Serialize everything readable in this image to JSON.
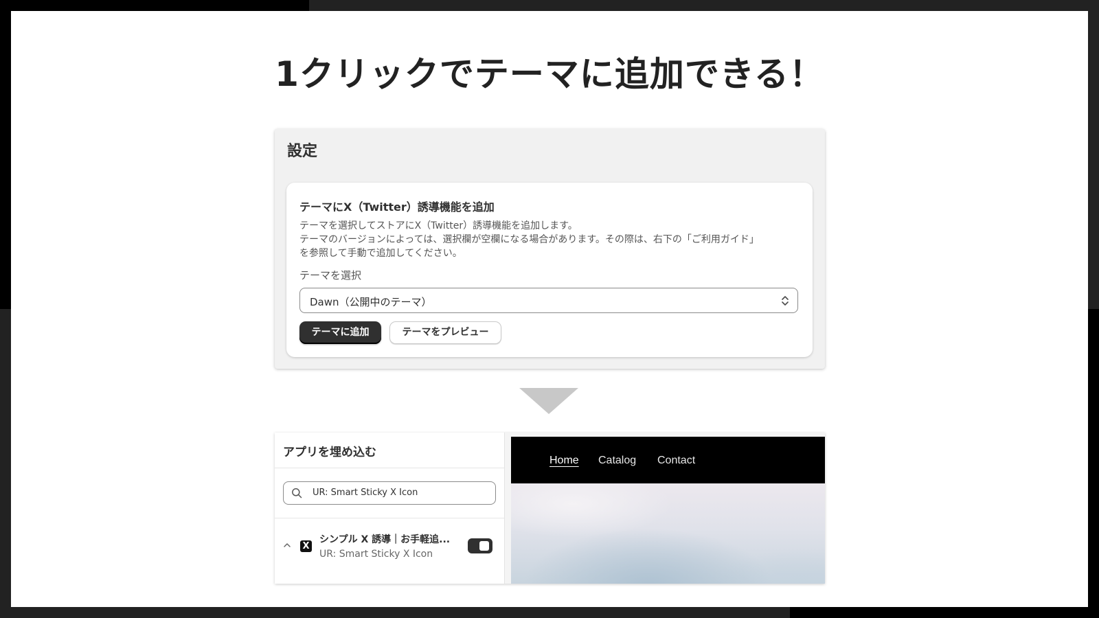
{
  "headline": "1クリックでテーマに追加できる！",
  "settings": {
    "title": "設定",
    "card": {
      "heading": "テーマにX（Twitter）誘導機能を追加",
      "description_lines": [
        "テーマを選択してストアにX（Twitter）誘導機能を追加します。",
        "テーマのバージョンによっては、選択欄が空欄になる場合があります。その際は、右下の「ご利用ガイド」",
        "を参照して手動で追加してください。"
      ],
      "select_label": "テーマを選択",
      "select_value": "Dawn（公開中のテーマ）",
      "add_button": "テーマに追加",
      "preview_button": "テーマをプレビュー"
    }
  },
  "embed": {
    "title": "アプリを埋め込む",
    "search_value": "UR: Smart Sticky X Icon",
    "app": {
      "icon_letter": "X",
      "name": "シンプル X 誘導｜お手軽追...",
      "subtitle": "UR: Smart Sticky X Icon",
      "enabled": true
    }
  },
  "preview": {
    "nav": [
      "Home",
      "Catalog",
      "Contact"
    ]
  },
  "icons": [
    "select-chevron-icon",
    "search-icon",
    "collapse-chevron-icon",
    "x-app-icon",
    "down-arrow-icon"
  ]
}
